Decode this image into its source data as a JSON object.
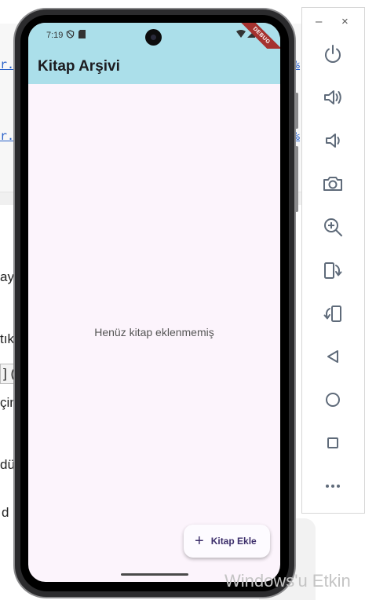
{
  "background": {
    "fragments_top": [
      "r.",
      "r."
    ],
    "fragments_right": [
      "%",
      "%"
    ],
    "text_fragments": [
      "aye",
      "tık",
      "] (",
      "çin",
      "düz",
      "d"
    ],
    "watermark": "Windows'u Etkin"
  },
  "device": {
    "status_bar": {
      "time": "7:19",
      "debug_label": "DEBUG"
    }
  },
  "app": {
    "title": "Kitap Arşivi",
    "empty_message": "Henüz kitap eklenmemiş",
    "fab": {
      "icon": "plus-icon",
      "label": "Kitap Ekle"
    },
    "colors": {
      "app_bar": "#abdfea",
      "background": "#fcf4fc",
      "fab_text": "#3d2f6b"
    }
  },
  "toolbar": {
    "window_controls": [
      "–",
      "×"
    ],
    "buttons": [
      "power",
      "volume-up",
      "volume-down",
      "camera",
      "zoom-in",
      "rotate-left",
      "rotate-right",
      "back",
      "home",
      "overview",
      "more"
    ]
  }
}
